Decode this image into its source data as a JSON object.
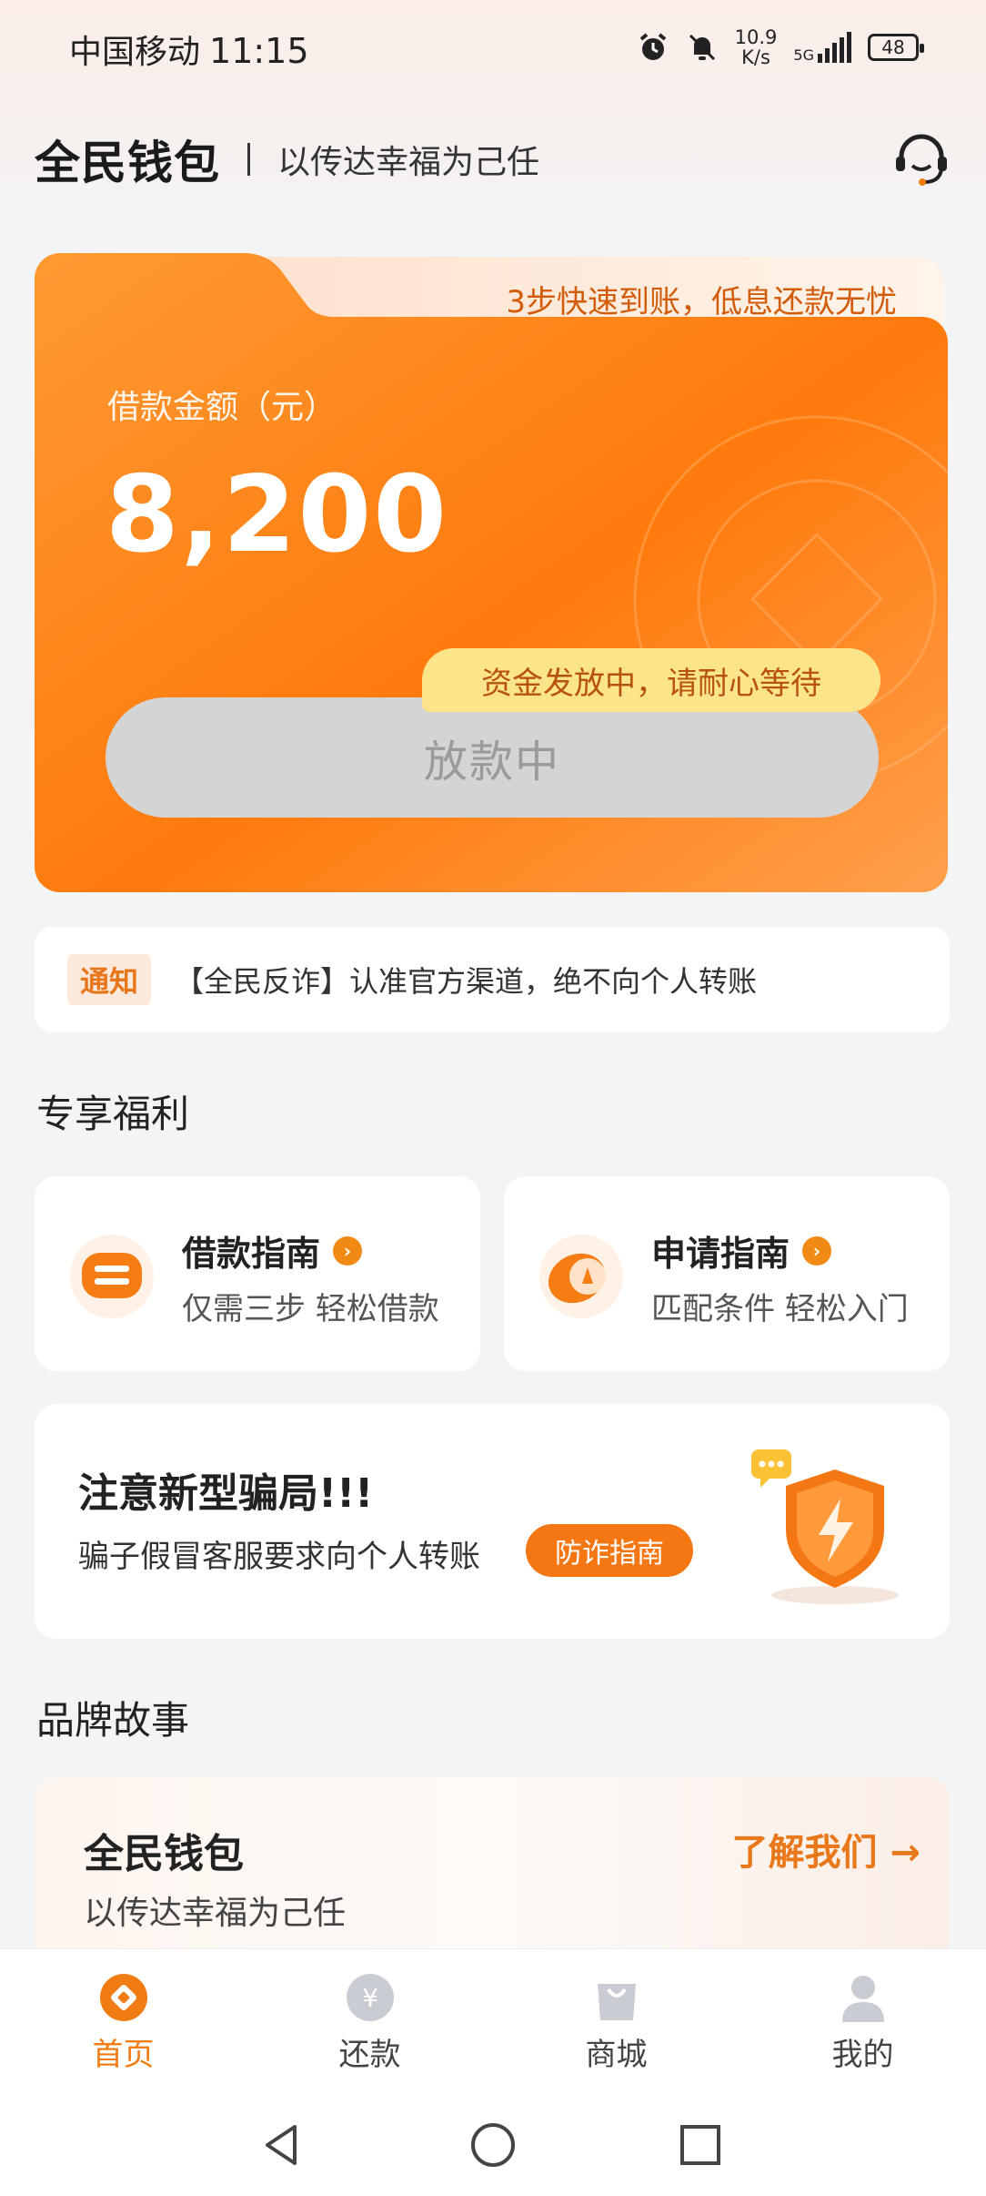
{
  "status_bar": {
    "carrier": "中国移动",
    "time": "11:15",
    "net_speed_value": "10.9",
    "net_speed_unit": "K/s",
    "signal_label": "5G",
    "battery": "48"
  },
  "header": {
    "brand": "全民钱包",
    "slogan": "以传达幸福为己任",
    "service_icon": "customer-service-headset-icon"
  },
  "loan_card": {
    "tab_text": "3步快速到账，低息还款无忧",
    "amount_label": "借款金额（元）",
    "amount": "8,200",
    "status_tip": "资金发放中，请耐心等待",
    "button_label": "放款中",
    "colors": {
      "card_top": "#ff8a1f",
      "card_bottom": "#ff7a0a",
      "tip_bg": "#fbe48a",
      "button_bg": "#d4d4d4"
    }
  },
  "notice": {
    "tag": "通知",
    "text": "【全民反诈】认准官方渠道，绝不向个人转账"
  },
  "benefits": {
    "section_title": "专享福利",
    "cards": [
      {
        "title": "借款指南",
        "subtitle": "仅需三步 轻松借款",
        "icon": "loan-guide-icon"
      },
      {
        "title": "申请指南",
        "subtitle": "匹配条件 轻松入门",
        "icon": "apply-guide-icon"
      }
    ]
  },
  "fraud": {
    "title": "注意新型骗局!!!",
    "subtitle": "骗子假冒客服要求向个人转账",
    "button": "防诈指南",
    "icon": "shield-lightning-icon"
  },
  "brand_story": {
    "section_title": "品牌故事",
    "title": "全民钱包",
    "subtitle": "以传达幸福为己任",
    "link": "了解我们 →"
  },
  "tabbar": {
    "items": [
      {
        "label": "首页",
        "icon": "home-icon",
        "active": true
      },
      {
        "label": "还款",
        "icon": "repay-yen-icon",
        "active": false
      },
      {
        "label": "商城",
        "icon": "shopping-bag-icon",
        "active": false
      },
      {
        "label": "我的",
        "icon": "profile-icon",
        "active": false
      }
    ],
    "active_color": "#f07c13"
  },
  "navbar": {
    "buttons": [
      "back-icon",
      "home-circle-icon",
      "recents-icon"
    ]
  }
}
